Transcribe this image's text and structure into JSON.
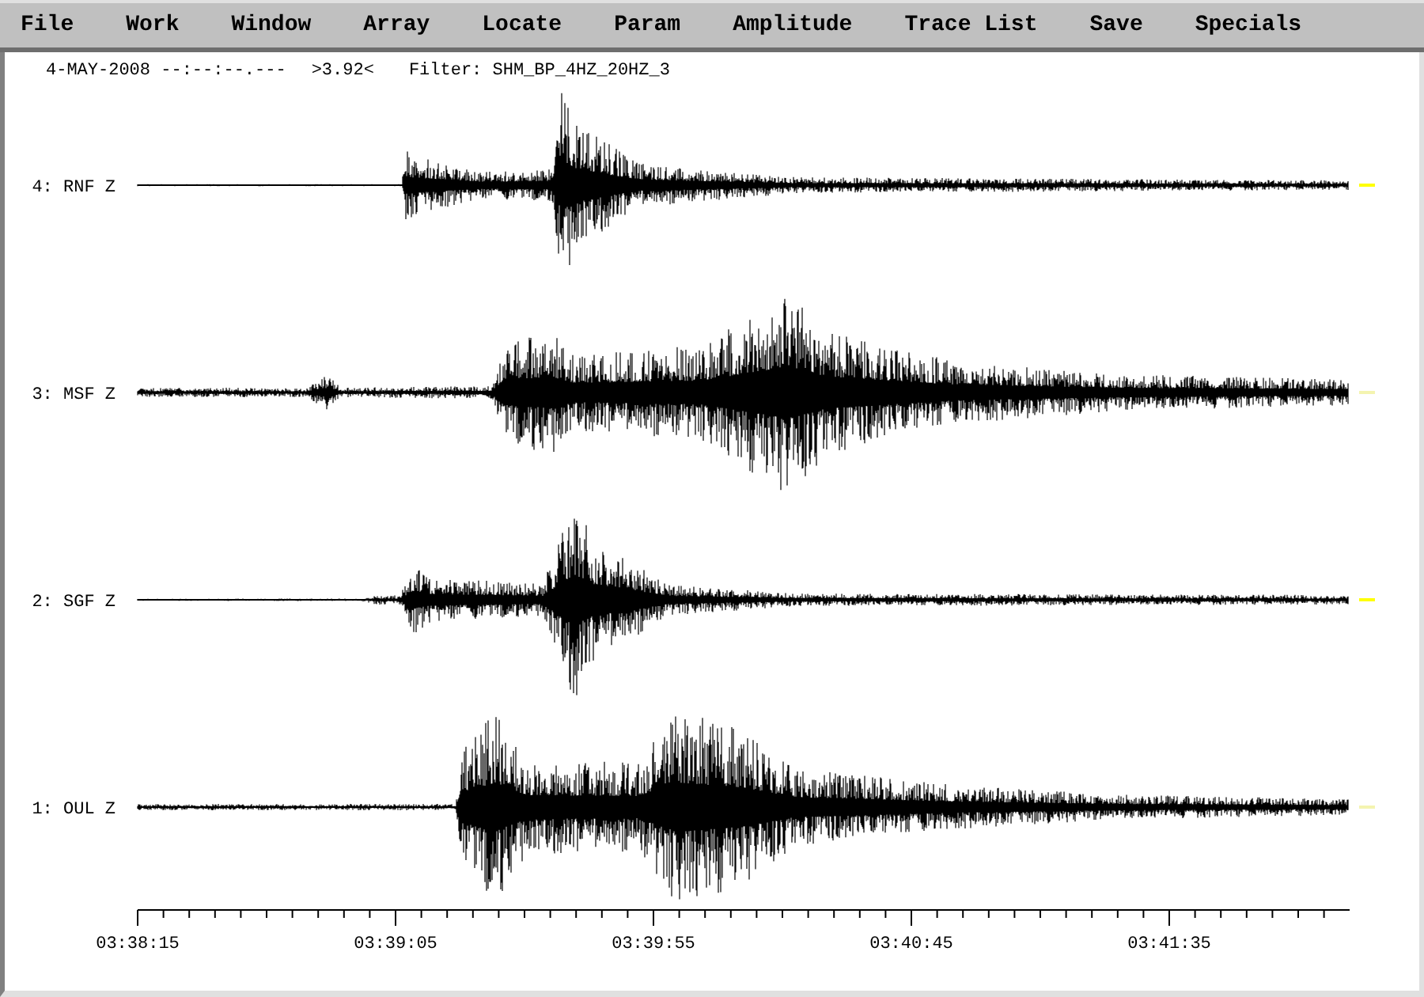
{
  "menu": [
    "File",
    "Work",
    "Window",
    "Array",
    "Locate",
    "Param",
    "Amplitude",
    "Trace List",
    "Save",
    "Specials"
  ],
  "header": {
    "date_time": "4-MAY-2008 --:--:--.---",
    "value": ">3.92<",
    "filter": "Filter: SHM_BP_4HZ_20HZ_3"
  },
  "traces": [
    {
      "label": "4: RNF Z",
      "color": "#ffff00"
    },
    {
      "label": "3: MSF Z",
      "color": "#f4f4b0"
    },
    {
      "label": "2: SGF Z",
      "color": "#ffff00"
    },
    {
      "label": "1: OUL Z",
      "color": "#f4f4b0"
    }
  ],
  "time_axis": {
    "labels": [
      "03:38:15",
      "03:39:05",
      "03:39:55",
      "03:40:45",
      "03:41:35"
    ]
  }
}
